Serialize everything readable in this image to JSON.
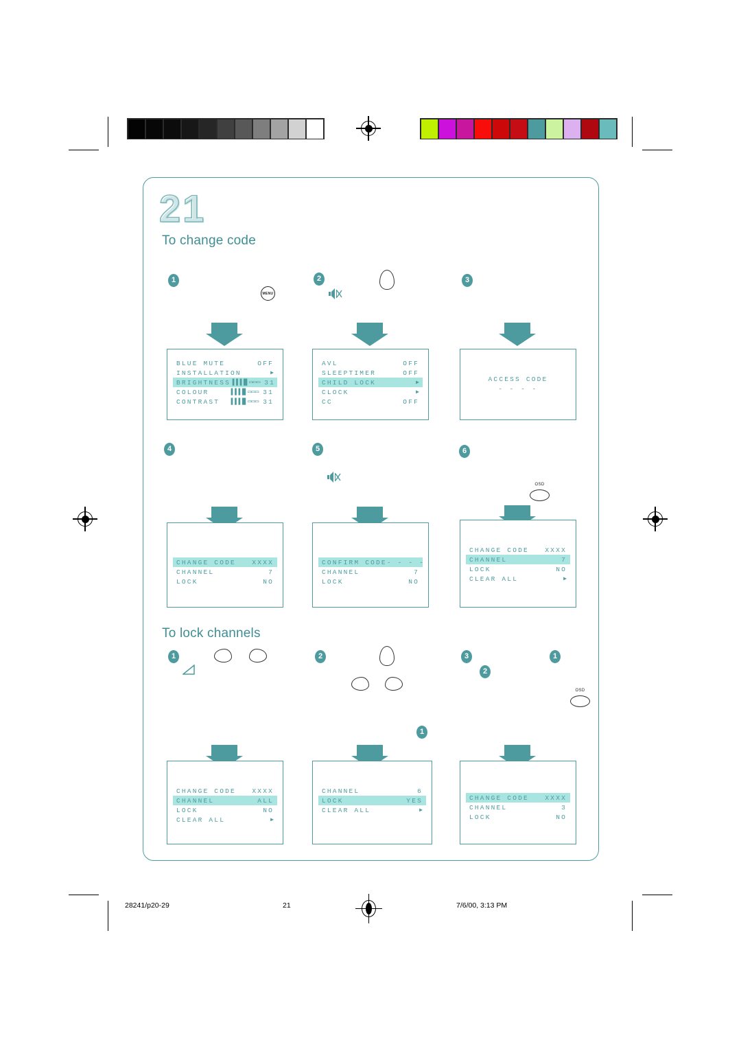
{
  "page": {
    "number": "21",
    "sections": [
      {
        "id": "change-code",
        "title": "To change code"
      },
      {
        "id": "lock-channels",
        "title": "To lock channels"
      }
    ]
  },
  "badges": {
    "b1": "1",
    "b2": "2",
    "b3": "3",
    "b4": "4",
    "b5": "5",
    "b6": "6"
  },
  "keys": {
    "menu_label": "MENU",
    "osd_label": "OSD",
    "mute_icon": "mute-icon",
    "volume_icon": "volume-icon",
    "up_key_icon": "up-cursor-key",
    "down_key_icon": "down-cursor-key",
    "left_key_icon": "left-cursor-key",
    "right_key_icon": "right-cursor-key"
  },
  "colors": {
    "teal": "#4e9b9f",
    "osd_text": "#4e9b9f",
    "highlight": "#a8e4e0",
    "heading": "#3f8e94"
  },
  "osd_screens": [
    {
      "id": "screen-1",
      "rows": [
        {
          "label": "BLUE MUTE",
          "value": "OFF",
          "highlight": false,
          "bar": ""
        },
        {
          "label": "INSTALLATION",
          "value": "▶",
          "highlight": false,
          "bar": ""
        },
        {
          "label": "BRIGHTNESS",
          "value": "31",
          "highlight": true,
          "bar": "▐▐▐▐▌▭▭▭"
        },
        {
          "label": "COLOUR",
          "value": "31",
          "highlight": false,
          "bar": "▐▐▐▐▌▭▭▭"
        },
        {
          "label": "CONTRAST",
          "value": "31",
          "highlight": false,
          "bar": "▐▐▐▐▌▭▭▭"
        }
      ]
    },
    {
      "id": "screen-2",
      "rows": [
        {
          "label": "AVL",
          "value": "OFF",
          "highlight": false,
          "bar": ""
        },
        {
          "label": "SLEEPTIMER",
          "value": "OFF",
          "highlight": false,
          "bar": ""
        },
        {
          "label": "CHILD LOCK",
          "value": "▶",
          "highlight": true,
          "bar": ""
        },
        {
          "label": "CLOCK",
          "value": "▶",
          "highlight": false,
          "bar": ""
        },
        {
          "label": "CC",
          "value": "OFF",
          "highlight": false,
          "bar": ""
        }
      ]
    },
    {
      "id": "screen-3",
      "centered": {
        "title": "ACCESS CODE",
        "dashes": "- - - -"
      },
      "rows": []
    },
    {
      "id": "screen-4",
      "rows": [
        {
          "label": "CHANGE CODE",
          "value": "XXXX",
          "highlight": true,
          "bar": ""
        },
        {
          "label": "CHANNEL",
          "value": "7",
          "highlight": false,
          "bar": ""
        },
        {
          "label": "LOCK",
          "value": "NO",
          "highlight": false,
          "bar": ""
        }
      ]
    },
    {
      "id": "screen-5",
      "rows": [
        {
          "label": "CONFIRM CODE",
          "value": "- - - -",
          "highlight": true,
          "bar": ""
        },
        {
          "label": "CHANNEL",
          "value": "7",
          "highlight": false,
          "bar": ""
        },
        {
          "label": "LOCK",
          "value": "NO",
          "highlight": false,
          "bar": ""
        }
      ]
    },
    {
      "id": "screen-6",
      "rows": [
        {
          "label": "CHANGE CODE",
          "value": "XXXX",
          "highlight": false,
          "bar": ""
        },
        {
          "label": "CHANNEL",
          "value": "7",
          "highlight": true,
          "bar": ""
        },
        {
          "label": "LOCK",
          "value": "NO",
          "highlight": false,
          "bar": ""
        },
        {
          "label": "CLEAR ALL",
          "value": "▶",
          "highlight": false,
          "bar": ""
        }
      ]
    },
    {
      "id": "screen-7",
      "rows": [
        {
          "label": "CHANGE CODE",
          "value": "XXXX",
          "highlight": false,
          "bar": ""
        },
        {
          "label": "CHANNEL",
          "value": "ALL",
          "highlight": true,
          "bar": ""
        },
        {
          "label": "LOCK",
          "value": "NO",
          "highlight": false,
          "bar": ""
        },
        {
          "label": "CLEAR ALL",
          "value": "▶",
          "highlight": false,
          "bar": ""
        }
      ]
    },
    {
      "id": "screen-8",
      "rows": [
        {
          "label": "CHANNEL",
          "value": "6",
          "highlight": false,
          "bar": ""
        },
        {
          "label": "LOCK",
          "value": "YES",
          "highlight": true,
          "bar": ""
        },
        {
          "label": "CLEAR ALL",
          "value": "▶",
          "highlight": false,
          "bar": ""
        }
      ]
    },
    {
      "id": "screen-9",
      "rows": [
        {
          "label": "CHANGE CODE",
          "value": "XXXX",
          "highlight": true,
          "bar": ""
        },
        {
          "label": "CHANNEL",
          "value": "3",
          "highlight": false,
          "bar": ""
        },
        {
          "label": "LOCK",
          "value": "NO",
          "highlight": false,
          "bar": ""
        }
      ]
    }
  ],
  "calibration": {
    "gray_patches": [
      "#030303",
      "#070707",
      "#0c0c0c",
      "#171717",
      "#262626",
      "#404040",
      "#585858",
      "#7e7e7e",
      "#a3a3a3",
      "#d2d2d2",
      "#ffffff"
    ],
    "color_patches": [
      "#c0f000",
      "#cc11dd",
      "#c8169f",
      "#f80d0b",
      "#cc0808",
      "#c40d15",
      "#4e9b9f",
      "#ccf4a0",
      "#ddb0f0",
      "#b00810",
      "#69bcbb"
    ]
  },
  "footer": {
    "doc_id": "28241/p20-29",
    "page_number": "21",
    "timestamp": "7/6/00, 3:13 PM"
  }
}
